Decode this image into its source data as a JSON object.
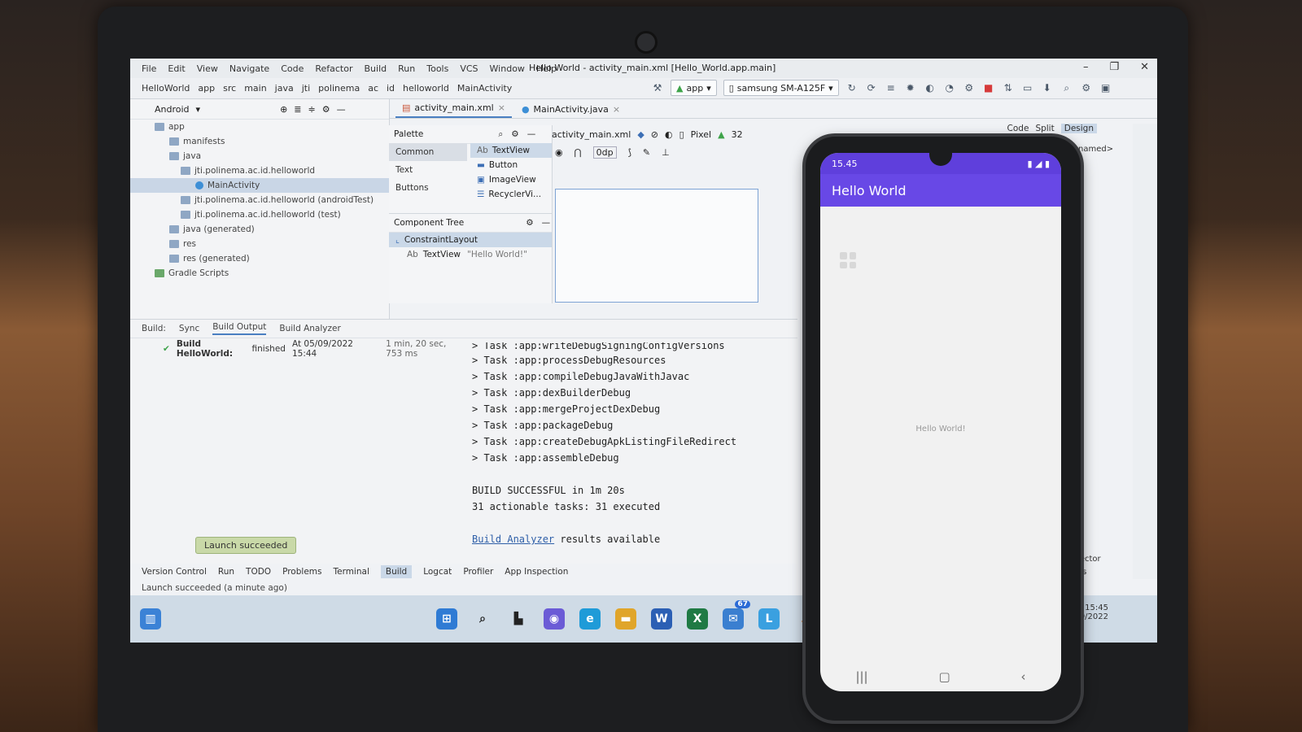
{
  "ide": {
    "window_title": "Hello World - activity_main.xml [Hello_World.app.main]",
    "menu": [
      "File",
      "Edit",
      "View",
      "Navigate",
      "Code",
      "Refactor",
      "Build",
      "Run",
      "Tools",
      "VCS",
      "Window",
      "Help"
    ],
    "breadcrumb": [
      "HelloWorld",
      "app",
      "src",
      "main",
      "java",
      "jti",
      "polinema",
      "ac",
      "id",
      "helloworld",
      "MainActivity"
    ],
    "run_config": "app",
    "device": "samsung SM-A125F",
    "project_view": "Android",
    "tree": [
      "app",
      "manifests",
      "java",
      "jti.polinema.ac.id.helloworld",
      "MainActivity",
      "jti.polinema.ac.id.helloworld (androidTest)",
      "jti.polinema.ac.id.helloworld (test)",
      "java (generated)",
      "res",
      "res (generated)",
      "Gradle Scripts"
    ],
    "tabs": [
      "activity_main.xml",
      "MainActivity.java"
    ],
    "view_modes": [
      "Code",
      "Split",
      "Design"
    ],
    "palette": {
      "title": "Palette",
      "categories": [
        "Common",
        "Text",
        "Buttons"
      ],
      "items": [
        "TextView",
        "Button",
        "ImageView",
        "RecyclerVi..."
      ]
    },
    "component_tree": {
      "title": "Component Tree",
      "root": "ConstraintLayout",
      "child_type": "TextView",
      "child_value": "\"Hello World!\""
    },
    "design_toolbar": {
      "file": "activity_main.xml",
      "device": "Pixel",
      "api": "32",
      "margin": "0dp"
    },
    "build": {
      "tabs": [
        "Build:",
        "Sync",
        "Build Output",
        "Build Analyzer"
      ],
      "result_label": "Build HelloWorld:",
      "result_status": "finished",
      "result_time": "At 05/09/2022 15:44",
      "duration": "1 min, 20 sec, 753 ms",
      "console": [
        "> Task :app:writeDebugSigningConfigVersions",
        "> Task :app:processDebugResources",
        "> Task :app:compileDebugJavaWithJavac",
        "> Task :app:dexBuilderDebug",
        "> Task :app:mergeProjectDexDebug",
        "> Task :app:packageDebug",
        "> Task :app:createDebugApkListingFileRedirect",
        "> Task :app:assembleDebug"
      ],
      "success": "BUILD SUCCESSFUL in 1m 20s",
      "tasks": "31 actionable tasks: 31 executed",
      "analyzer_link": "Build Analyzer",
      "analyzer_suffix": " results available",
      "toast": "Launch succeeded"
    },
    "bottom_tabs": [
      "Version Control",
      "Run",
      "TODO",
      "Problems",
      "Terminal",
      "Build",
      "Logcat",
      "Profiler",
      "App Inspection"
    ],
    "status": "Launch succeeded (a minute ago)",
    "right_labels": [
      "Inspector",
      "paces"
    ],
    "clock": "15:45",
    "clock_date": "9/2022",
    "component_name": "<unnamed>"
  },
  "taskbar": {
    "mail_badge": "67"
  },
  "phone": {
    "time": "15.45",
    "app_title": "Hello World",
    "content": "Hello World!"
  },
  "colors": {
    "app_bar": "#6848e6",
    "status_bar": "#5f3fdc",
    "link": "#2f5fa8"
  }
}
